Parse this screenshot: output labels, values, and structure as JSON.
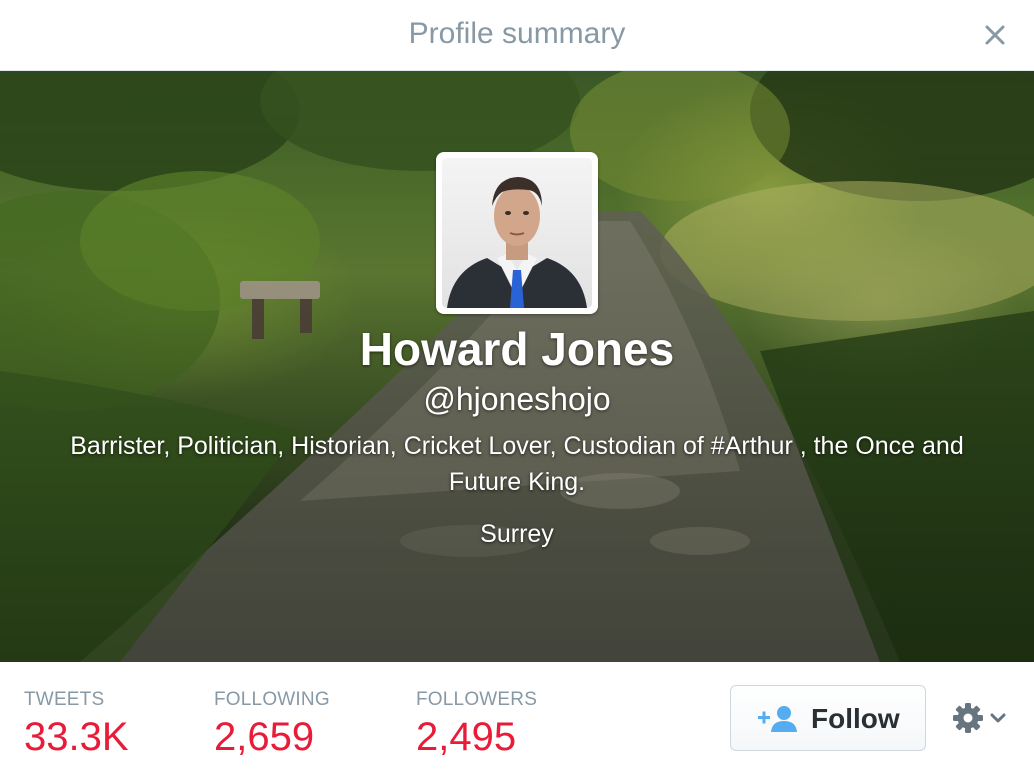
{
  "header": {
    "title": "Profile summary",
    "close_icon": "close-icon"
  },
  "profile": {
    "name": "Howard Jones",
    "handle": "@hjoneshojo",
    "bio": "Barrister, Politician, Historian, Cricket Lover, Custodian of #Arthur , the Once and Future King.",
    "location": "Surrey"
  },
  "stats": [
    {
      "label": "TWEETS",
      "value": "33.3K"
    },
    {
      "label": "FOLLOWING",
      "value": "2,659"
    },
    {
      "label": "FOLLOWERS",
      "value": "2,495"
    }
  ],
  "actions": {
    "follow_label": "Follow",
    "follow_icon": "add-user-icon",
    "settings_icon": "gear-icon",
    "menu_icon": "chevron-down-icon"
  },
  "colors": {
    "stat_value": "#e81c38",
    "stat_label": "#8899a6",
    "follow_icon": "#55acee",
    "header_title": "#8899a6"
  }
}
